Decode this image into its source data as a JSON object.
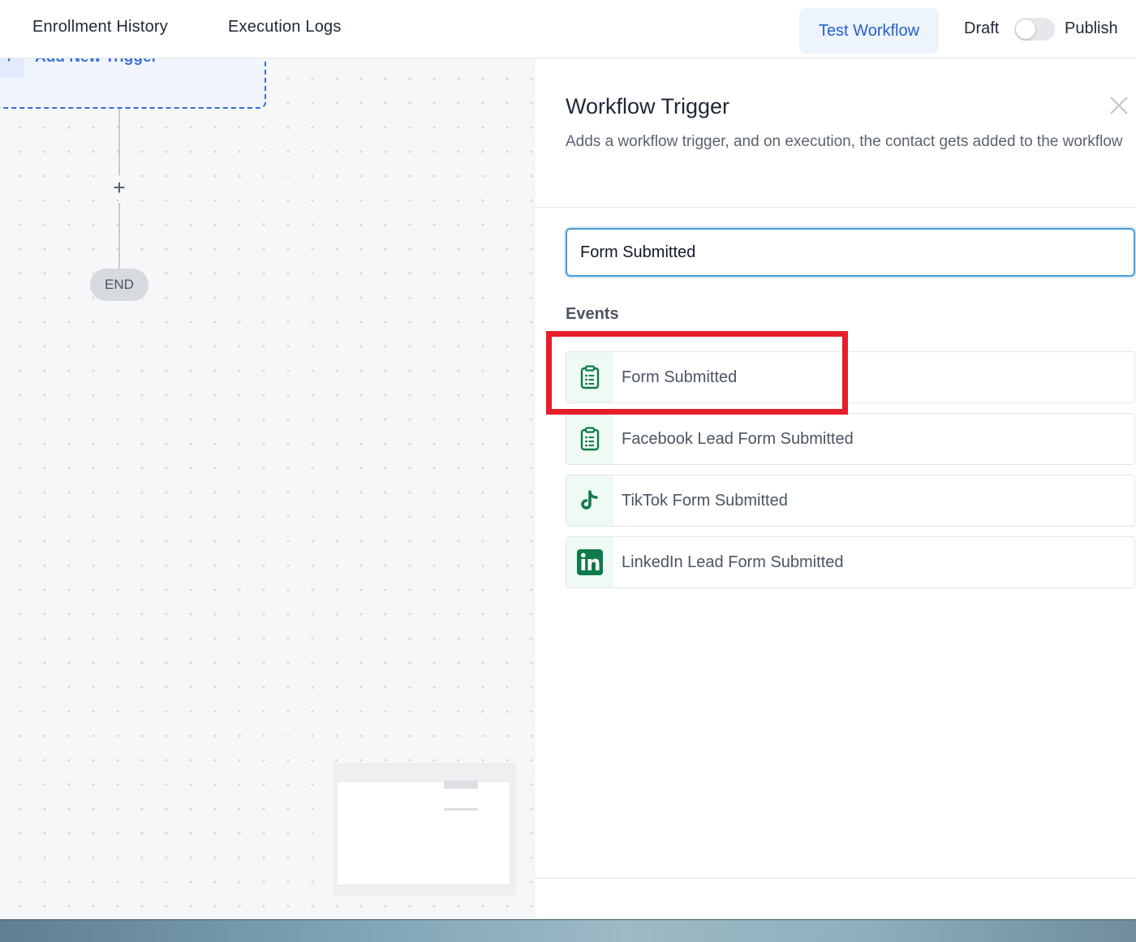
{
  "topbar": {
    "tabs": [
      {
        "label": "Enrollment History"
      },
      {
        "label": "Execution Logs"
      }
    ],
    "test_workflow_label": "Test Workflow",
    "draft_label": "Draft",
    "publish_label": "Publish",
    "publish_toggle_on": false
  },
  "canvas": {
    "add_trigger_label": "Add New Trigger",
    "add_step_symbol": "+",
    "end_label": "END"
  },
  "panel": {
    "title": "Workflow Trigger",
    "description": "Adds a workflow trigger, and on execution, the contact gets added to the workflow",
    "search": {
      "value": "Form Submitted",
      "placeholder": ""
    },
    "events_heading": "Events",
    "events": [
      {
        "label": "Form Submitted",
        "icon": "clipboard-icon"
      },
      {
        "label": "Facebook Lead Form Submitted",
        "icon": "clipboard-icon"
      },
      {
        "label": "TikTok Form Submitted",
        "icon": "tiktok-icon"
      },
      {
        "label": "LinkedIn Lead Form Submitted",
        "icon": "linkedin-icon"
      }
    ]
  },
  "colors": {
    "accent_blue": "#2563c9",
    "event_icon_green": "#0f7a4a",
    "highlight_red": "#e61e2b"
  }
}
